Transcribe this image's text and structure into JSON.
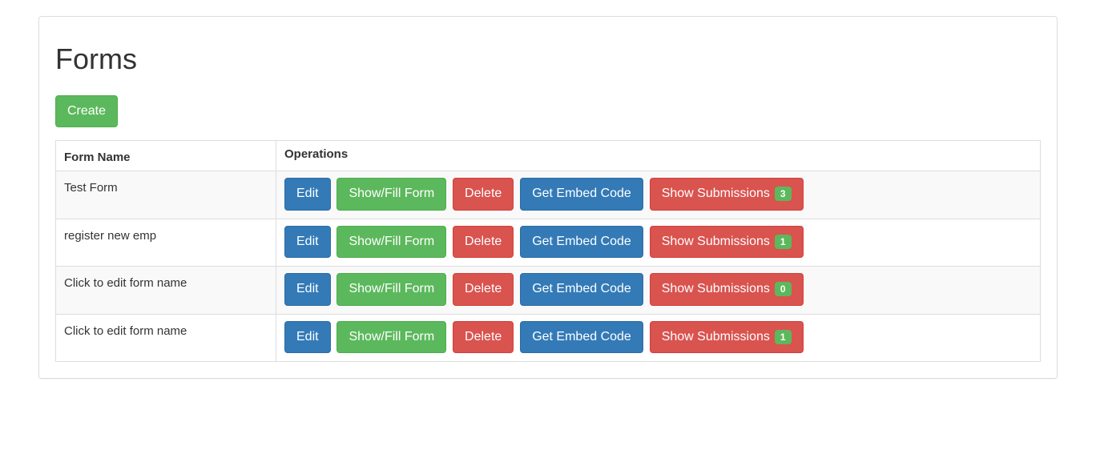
{
  "page": {
    "title": "Forms",
    "create_label": "Create",
    "columns": {
      "name": "Form Name",
      "operations": "Operations"
    }
  },
  "buttons": {
    "edit": "Edit",
    "show_fill": "Show/Fill Form",
    "delete": "Delete",
    "embed": "Get Embed Code",
    "submissions": "Show Submissions"
  },
  "forms": [
    {
      "name": "Test Form",
      "submissions": "3"
    },
    {
      "name": "register new emp",
      "submissions": "1"
    },
    {
      "name": "Click to edit form name",
      "submissions": "0"
    },
    {
      "name": "Click to edit form name",
      "submissions": "1"
    }
  ]
}
